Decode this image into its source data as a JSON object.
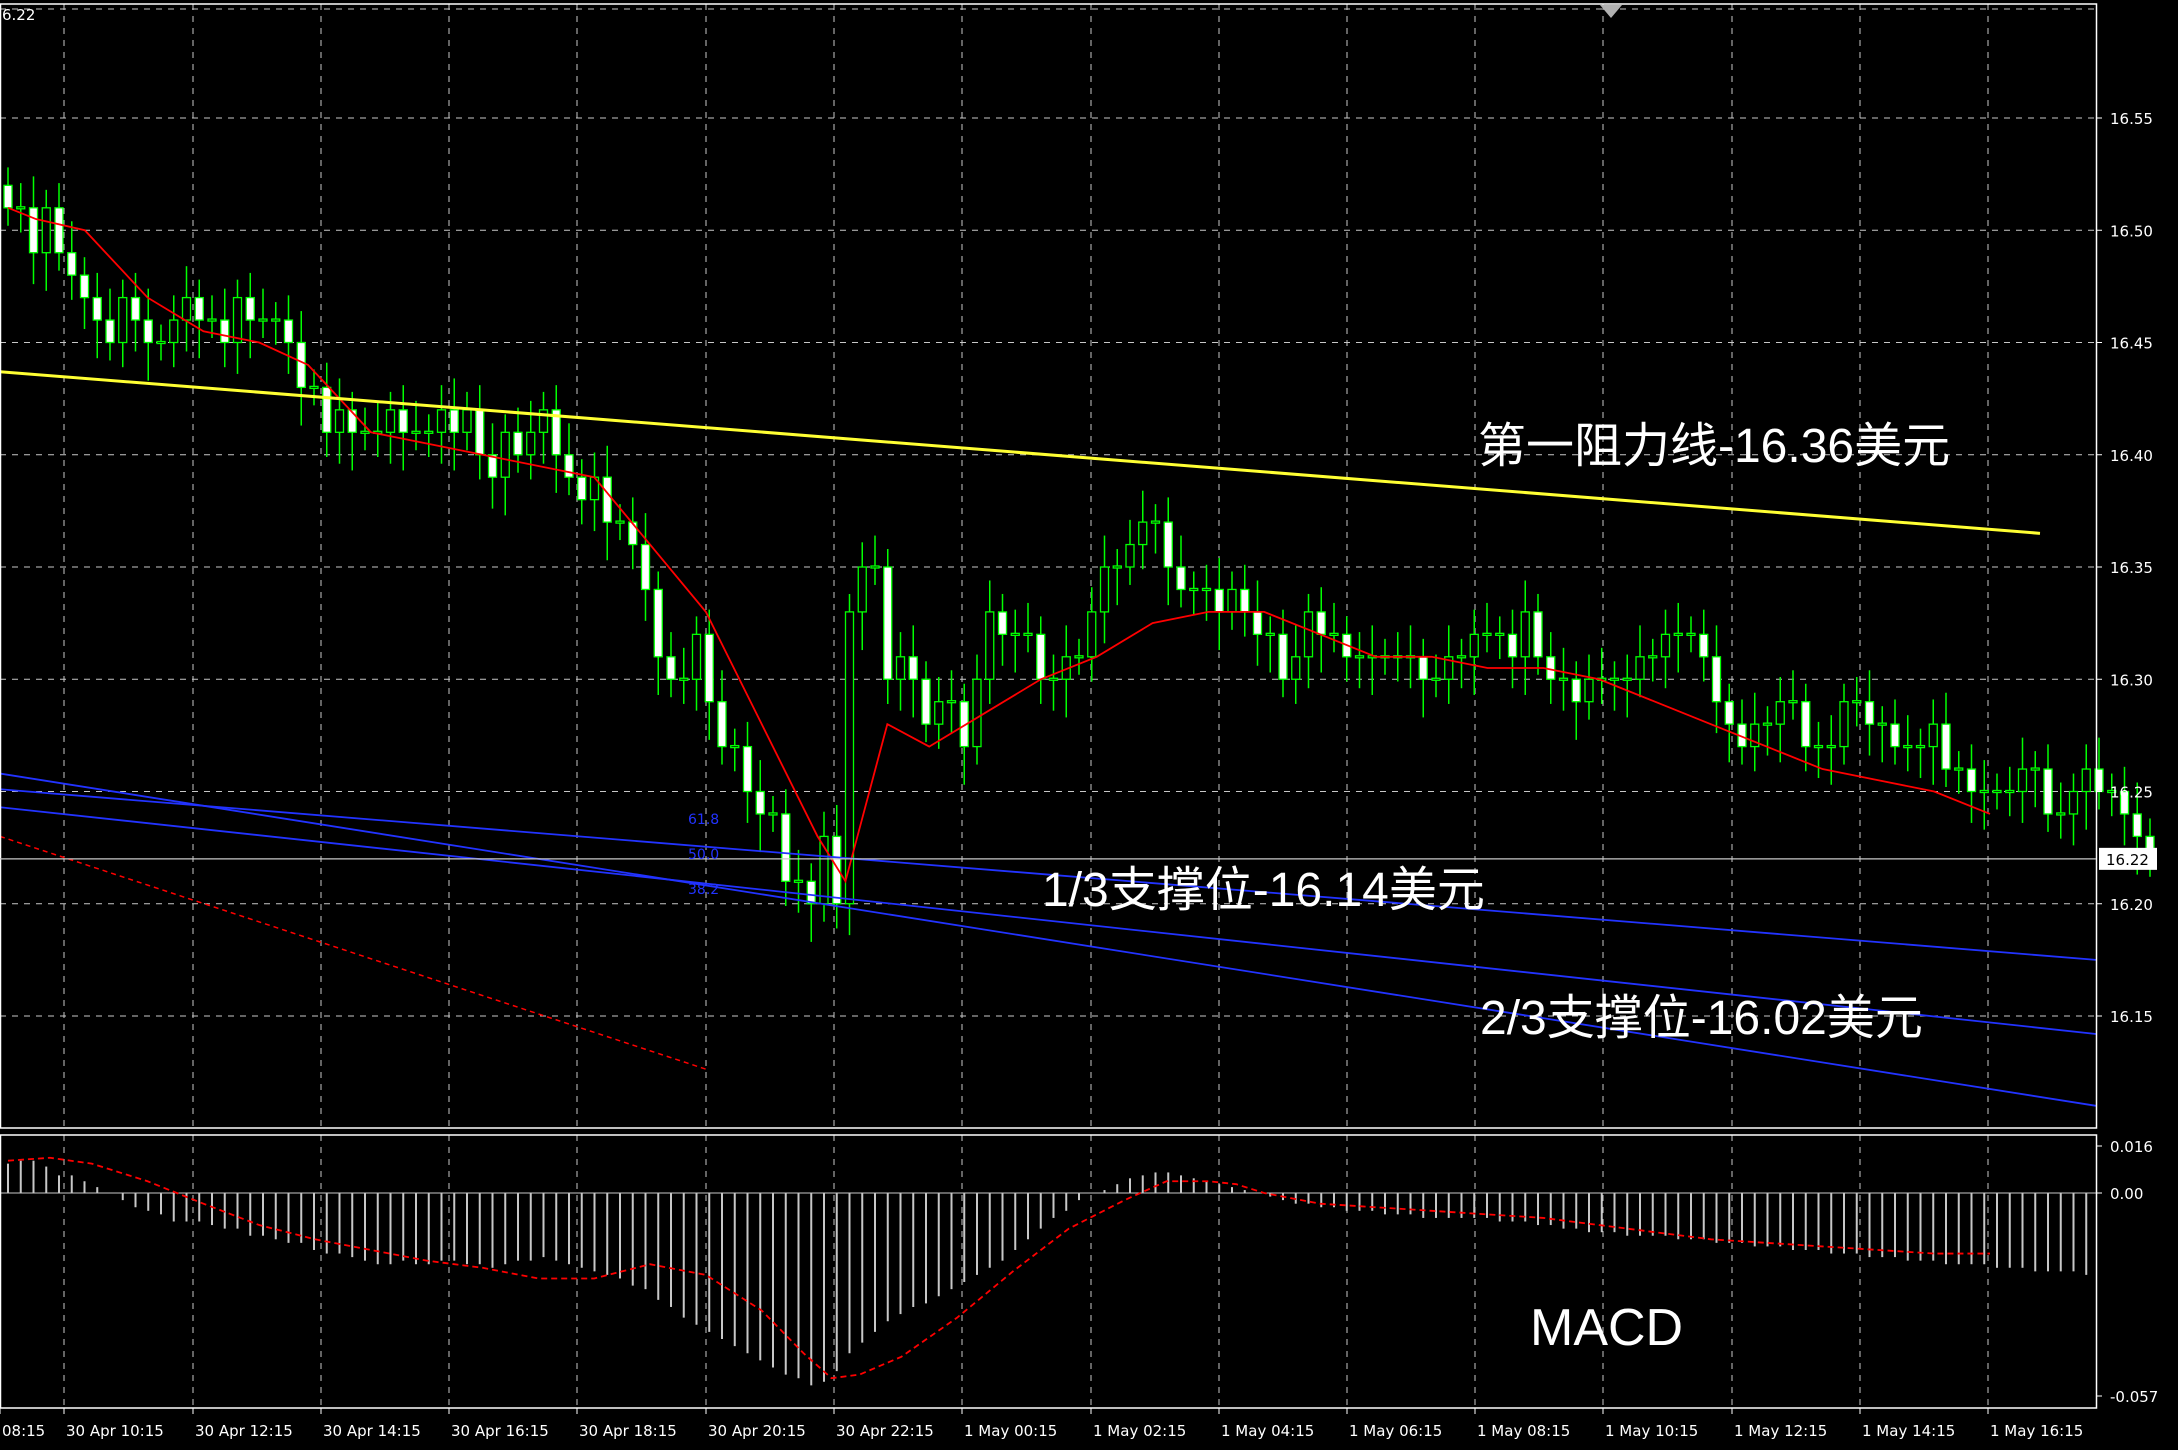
{
  "chart_data": [
    {
      "type": "candlestick",
      "title": "",
      "top_left_label": "6.22",
      "ylim": [
        16.095,
        16.6
      ],
      "y_ticks": [
        "16.55",
        "16.50",
        "16.45",
        "16.40",
        "16.35",
        "16.30",
        "16.25",
        "16.20",
        "16.15"
      ],
      "y_tick_values": [
        16.55,
        16.5,
        16.45,
        16.4,
        16.35,
        16.3,
        16.25,
        16.2,
        16.15
      ],
      "x_ticks": [
        "08:15",
        "30 Apr 10:15",
        "30 Apr 12:15",
        "30 Apr 14:15",
        "30 Apr 16:15",
        "30 Apr 18:15",
        "30 Apr 20:15",
        "30 Apr 22:15",
        "1 May 00:15",
        "1 May 02:15",
        "1 May 04:15",
        "1 May 06:15",
        "1 May 08:15",
        "1 May 10:15",
        "1 May 12:15",
        "1 May 14:15",
        "1 May 16:15"
      ],
      "current_price_label": "16.22",
      "current_price": 16.22,
      "grid": true,
      "colors": {
        "background": "#000000",
        "grid": "#c8c8c8",
        "candle_up": "#000000",
        "candle_down": "#ffffff",
        "candle_outline": "#00ff00",
        "moving_average": "#ff0000",
        "resistance_line": "#ffff33",
        "support_lines": "#2233ff",
        "current_price_line": "#c8c8c8"
      },
      "candles_close": [
        16.51,
        16.51,
        16.49,
        16.51,
        16.49,
        16.48,
        16.47,
        16.46,
        16.45,
        16.47,
        16.46,
        16.45,
        16.45,
        16.46,
        16.47,
        16.46,
        16.46,
        16.45,
        16.47,
        16.46,
        16.46,
        16.46,
        16.45,
        16.43,
        16.43,
        16.41,
        16.42,
        16.41,
        16.41,
        16.41,
        16.42,
        16.41,
        16.41,
        16.41,
        16.42,
        16.41,
        16.42,
        16.4,
        16.39,
        16.41,
        16.4,
        16.41,
        16.42,
        16.4,
        16.39,
        16.38,
        16.39,
        16.37,
        16.37,
        16.36,
        16.34,
        16.31,
        16.3,
        16.3,
        16.32,
        16.29,
        16.27,
        16.27,
        16.25,
        16.24,
        16.24,
        16.21,
        16.21,
        16.2,
        16.23,
        16.2,
        16.33,
        16.35,
        16.35,
        16.3,
        16.31,
        16.3,
        16.28,
        16.29,
        16.29,
        16.27,
        16.3,
        16.33,
        16.32,
        16.32,
        16.32,
        16.3,
        16.3,
        16.31,
        16.31,
        16.33,
        16.35,
        16.35,
        16.36,
        16.37,
        16.37,
        16.35,
        16.34,
        16.34,
        16.34,
        16.33,
        16.34,
        16.33,
        16.32,
        16.32,
        16.3,
        16.31,
        16.33,
        16.32,
        16.32,
        16.31,
        16.31,
        16.31,
        16.31,
        16.31,
        16.31,
        16.3,
        16.3,
        16.31,
        16.31,
        16.32,
        16.32,
        16.32,
        16.31,
        16.33,
        16.31,
        16.3,
        16.3,
        16.29,
        16.3,
        16.3,
        16.3,
        16.3,
        16.31,
        16.31,
        16.32,
        16.32,
        16.32,
        16.31,
        16.29,
        16.28,
        16.27,
        16.28,
        16.28,
        16.29,
        16.29,
        16.27,
        16.27,
        16.27,
        16.29,
        16.29,
        16.28,
        16.28,
        16.27,
        16.27,
        16.27,
        16.28,
        16.26,
        16.26,
        16.25,
        16.25,
        16.25,
        16.25,
        16.26,
        16.26,
        16.24,
        16.24,
        16.25,
        16.26,
        16.25,
        16.25,
        16.24,
        16.23,
        16.22
      ],
      "moving_average": [
        [
          0,
          16.51
        ],
        [
          20,
          16.505
        ],
        [
          55,
          16.5
        ],
        [
          100,
          16.47
        ],
        [
          140,
          16.455
        ],
        [
          180,
          16.45
        ],
        [
          215,
          16.44
        ],
        [
          260,
          16.41
        ],
        [
          300,
          16.405
        ],
        [
          340,
          16.4
        ],
        [
          380,
          16.395
        ],
        [
          420,
          16.39
        ],
        [
          460,
          16.36
        ],
        [
          500,
          16.33
        ],
        [
          540,
          16.28
        ],
        [
          580,
          16.23
        ],
        [
          600,
          16.21
        ],
        [
          630,
          16.28
        ],
        [
          660,
          16.27
        ],
        [
          700,
          16.285
        ],
        [
          740,
          16.3
        ],
        [
          780,
          16.31
        ],
        [
          820,
          16.325
        ],
        [
          860,
          16.33
        ],
        [
          900,
          16.33
        ],
        [
          940,
          16.32
        ],
        [
          980,
          16.31
        ],
        [
          1020,
          16.31
        ],
        [
          1060,
          16.305
        ],
        [
          1100,
          16.305
        ],
        [
          1140,
          16.3
        ],
        [
          1180,
          16.29
        ],
        [
          1220,
          16.28
        ],
        [
          1260,
          16.27
        ],
        [
          1300,
          16.26
        ],
        [
          1340,
          16.255
        ],
        [
          1380,
          16.25
        ],
        [
          1420,
          16.24
        ]
      ],
      "resistance_line": {
        "label": "第一阻力线-16.36美元",
        "start": 16.437,
        "end": 16.365
      },
      "support_lines": [
        {
          "label": "1/3支撑位-16.14美元",
          "fib": "50.0",
          "start": 16.251,
          "end": 16.175
        },
        {
          "label": "2/3支撑位-16.02美元",
          "fib": "38.2",
          "start": 16.243,
          "end": 16.142
        },
        {
          "fib": "61.8",
          "start": 16.258,
          "end": 16.11
        }
      ],
      "fib_labels": [
        "61.8",
        "50.0",
        "38.2"
      ]
    },
    {
      "type": "bar",
      "name": "MACD",
      "ylim": [
        -0.057,
        0.016
      ],
      "y_ticks": [
        "0.016",
        "0.00",
        "-0.057"
      ],
      "y_tick_values": [
        0.016,
        0.0,
        -0.057
      ],
      "histogram": [
        0.01,
        0.011,
        0.011,
        0.009,
        0.006,
        0.006,
        0.004,
        0.002,
        0.0,
        -0.002,
        -0.004,
        -0.005,
        -0.006,
        -0.008,
        -0.008,
        -0.008,
        -0.009,
        -0.01,
        -0.01,
        -0.012,
        -0.012,
        -0.013,
        -0.014,
        -0.014,
        -0.016,
        -0.017,
        -0.017,
        -0.018,
        -0.019,
        -0.02,
        -0.02,
        -0.019,
        -0.02,
        -0.02,
        -0.019,
        -0.019,
        -0.02,
        -0.02,
        -0.021,
        -0.02,
        -0.019,
        -0.019,
        -0.018,
        -0.019,
        -0.02,
        -0.021,
        -0.022,
        -0.023,
        -0.024,
        -0.026,
        -0.027,
        -0.03,
        -0.032,
        -0.035,
        -0.037,
        -0.039,
        -0.041,
        -0.043,
        -0.045,
        -0.047,
        -0.049,
        -0.051,
        -0.052,
        -0.054,
        -0.053,
        -0.05,
        -0.045,
        -0.042,
        -0.039,
        -0.036,
        -0.034,
        -0.032,
        -0.031,
        -0.029,
        -0.027,
        -0.025,
        -0.023,
        -0.021,
        -0.019,
        -0.016,
        -0.013,
        -0.01,
        -0.007,
        -0.005,
        -0.002,
        0.0,
        0.001,
        0.003,
        0.005,
        0.006,
        0.007,
        0.007,
        0.006,
        0.005,
        0.004,
        0.003,
        0.002,
        0.001,
        0.0,
        -0.001,
        -0.002,
        -0.003,
        -0.003,
        -0.004,
        -0.004,
        -0.005,
        -0.005,
        -0.005,
        -0.006,
        -0.006,
        -0.006,
        -0.007,
        -0.007,
        -0.007,
        -0.007,
        -0.007,
        -0.007,
        -0.008,
        -0.008,
        -0.008,
        -0.009,
        -0.009,
        -0.01,
        -0.01,
        -0.011,
        -0.011,
        -0.011,
        -0.012,
        -0.012,
        -0.012,
        -0.012,
        -0.013,
        -0.013,
        -0.013,
        -0.014,
        -0.014,
        -0.014,
        -0.015,
        -0.015,
        -0.015,
        -0.016,
        -0.016,
        -0.016,
        -0.017,
        -0.017,
        -0.017,
        -0.018,
        -0.018,
        -0.018,
        -0.019,
        -0.019,
        -0.019,
        -0.02,
        -0.02,
        -0.02,
        -0.02,
        -0.021,
        -0.021,
        -0.021,
        -0.022,
        -0.022,
        -0.022,
        -0.022,
        -0.023
      ],
      "signal": [
        [
          0,
          0.011
        ],
        [
          30,
          0.012
        ],
        [
          60,
          0.01
        ],
        [
          100,
          0.004
        ],
        [
          140,
          -0.003
        ],
        [
          180,
          -0.009
        ],
        [
          220,
          -0.013
        ],
        [
          260,
          -0.016
        ],
        [
          300,
          -0.019
        ],
        [
          340,
          -0.021
        ],
        [
          380,
          -0.024
        ],
        [
          420,
          -0.024
        ],
        [
          460,
          -0.02
        ],
        [
          500,
          -0.023
        ],
        [
          540,
          -0.033
        ],
        [
          570,
          -0.045
        ],
        [
          590,
          -0.052
        ],
        [
          610,
          -0.051
        ],
        [
          640,
          -0.046
        ],
        [
          680,
          -0.035
        ],
        [
          720,
          -0.022
        ],
        [
          760,
          -0.01
        ],
        [
          800,
          -0.002
        ],
        [
          830,
          0.004
        ],
        [
          860,
          0.004
        ],
        [
          880,
          0.003
        ],
        [
          900,
          0.0
        ],
        [
          940,
          -0.003
        ],
        [
          980,
          -0.004
        ],
        [
          1020,
          -0.005
        ],
        [
          1060,
          -0.006
        ],
        [
          1100,
          -0.007
        ],
        [
          1140,
          -0.009
        ],
        [
          1180,
          -0.011
        ],
        [
          1220,
          -0.013
        ],
        [
          1260,
          -0.014
        ],
        [
          1300,
          -0.015
        ],
        [
          1340,
          -0.016
        ],
        [
          1380,
          -0.017
        ],
        [
          1420,
          -0.017
        ]
      ],
      "colors": {
        "histogram": "#c8c8c8",
        "signal": "#ff0000",
        "zero_line": "#c8c8c8"
      }
    }
  ],
  "annotations": {
    "resistance": "第一阻力线-16.36美元",
    "support_1": "1/3支撑位-16.14美元",
    "support_2": "2/3支撑位-16.02美元",
    "macd": "MACD"
  }
}
